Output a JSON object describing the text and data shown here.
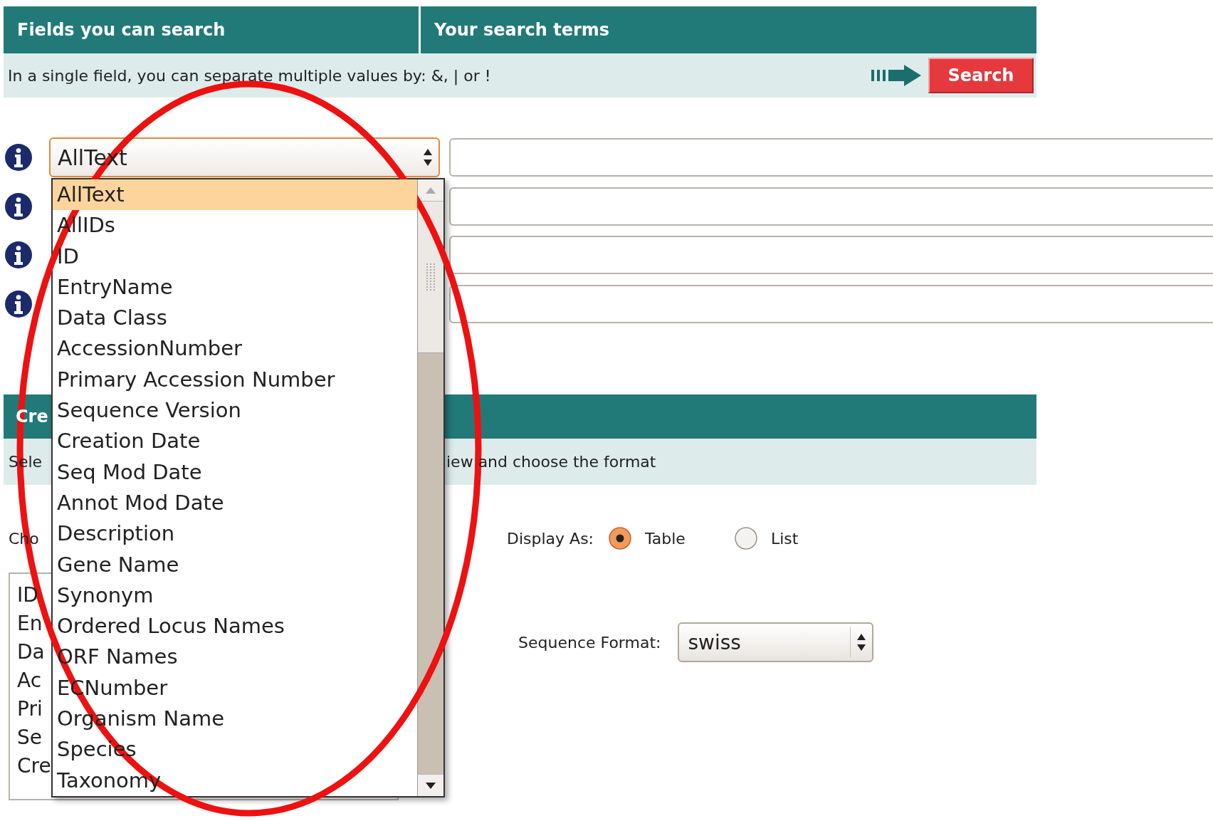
{
  "search_panel": {
    "headers": [
      "Fields you can search",
      "Your search terms"
    ],
    "hint": "In a single field, you can separate multiple values by: &, | or !",
    "search_button": "Search"
  },
  "search_rows": [
    {
      "kind": "with-select",
      "field": "AllText",
      "expanded": true
    },
    {
      "kind": "plain"
    },
    {
      "kind": "plain"
    },
    {
      "kind": "plain"
    }
  ],
  "dropdown_options": [
    {
      "label": "AllText",
      "selected": true
    },
    {
      "label": "AllIDs",
      "selected": false
    },
    {
      "label": "ID",
      "selected": false
    },
    {
      "label": "EntryName",
      "selected": false
    },
    {
      "label": "Data Class",
      "selected": false
    },
    {
      "label": "AccessionNumber",
      "selected": false
    },
    {
      "label": "Primary Accession Number",
      "selected": false
    },
    {
      "label": "Sequence Version",
      "selected": false
    },
    {
      "label": "Creation Date",
      "selected": false
    },
    {
      "label": "Seq Mod Date",
      "selected": false
    },
    {
      "label": "Annot Mod Date",
      "selected": false
    },
    {
      "label": "Description",
      "selected": false
    },
    {
      "label": "Gene Name",
      "selected": false
    },
    {
      "label": "Synonym",
      "selected": false
    },
    {
      "label": "Ordered Locus Names",
      "selected": false
    },
    {
      "label": "ORF Names",
      "selected": false
    },
    {
      "label": "ECNumber",
      "selected": false
    },
    {
      "label": "Organism Name",
      "selected": false
    },
    {
      "label": "Species",
      "selected": false
    },
    {
      "label": "Taxonomy",
      "selected": false
    }
  ],
  "results_panel": {
    "header": "Cre",
    "hint_left": "Sele",
    "hint_right": "iew and choose the format",
    "choose_label": "Cho",
    "columns_list": [
      "ID",
      "En",
      "Da",
      "Ac",
      "Pri",
      "Se",
      "Cre"
    ],
    "display_as": {
      "label": "Display As:",
      "options": [
        {
          "label": "Table",
          "selected": true
        },
        {
          "label": "List",
          "selected": false
        }
      ]
    },
    "sequence_format": {
      "label": "Sequence Format:",
      "value": "swiss"
    }
  }
}
